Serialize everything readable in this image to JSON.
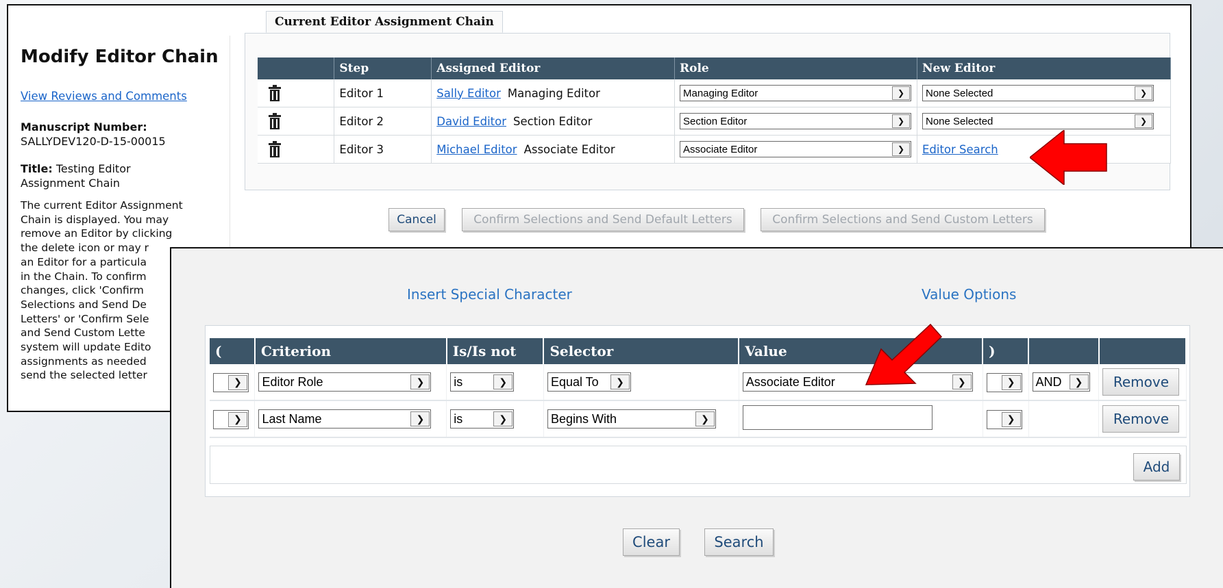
{
  "page_title": "Modify Editor Chain",
  "sidebar": {
    "view_reviews_link": "View Reviews and Comments",
    "manuscript_label": "Manuscript Number:",
    "manuscript_value": "SALLYDEV120-D-15-00015",
    "title_label": "Title:",
    "title_value_line1": "Testing Editor",
    "title_value_line2": "Assignment Chain",
    "description_lines": [
      "The current Editor Assignment",
      "Chain is displayed. You may",
      "remove an Editor by clicking",
      "the delete icon or may r",
      "an Editor for a particula",
      "in the Chain. To confirm",
      "changes, click 'Confirm",
      "Selections and Send De",
      "Letters' or 'Confirm Sele",
      "and Send Custom Lette",
      "system will update Edito",
      "assignments as needed",
      "send the selected letter"
    ]
  },
  "chain": {
    "tab_label": "Current Editor Assignment Chain",
    "headers": [
      "",
      "Step",
      "Assigned Editor",
      "Role",
      "New Editor"
    ],
    "rows": [
      {
        "step": "Editor 1",
        "editor_name": "Sally Editor",
        "editor_role": "Managing Editor",
        "role_select": "Managing Editor",
        "new_editor": "None Selected"
      },
      {
        "step": "Editor 2",
        "editor_name": "David Editor",
        "editor_role": "Section Editor",
        "role_select": "Section Editor",
        "new_editor": "None Selected"
      },
      {
        "step": "Editor 3",
        "editor_name": "Michael Editor",
        "editor_role": "Associate Editor",
        "role_select": "Associate Editor",
        "new_editor_link": "Editor Search"
      }
    ],
    "cancel_label": "Cancel",
    "confirm_default_label": "Confirm Selections and Send Default Letters",
    "confirm_custom_label": "Confirm Selections and Send Custom Letters"
  },
  "search": {
    "insert_special_char": "Insert Special Character",
    "value_options": "Value Options",
    "headers": [
      "(",
      "Criterion",
      "Is/Is not",
      "Selector",
      "Value",
      ")",
      "",
      ""
    ],
    "rows": [
      {
        "open": "",
        "criterion": "Editor Role",
        "is": "is",
        "selector": "Equal To",
        "value": "Associate Editor",
        "close": "",
        "conj": "AND",
        "remove": "Remove"
      },
      {
        "open": "",
        "criterion": "Last Name",
        "is": "is",
        "selector": "Begins With",
        "value": "",
        "close": "",
        "remove": "Remove"
      }
    ],
    "add_label": "Add",
    "clear_label": "Clear",
    "search_label": "Search"
  },
  "colors": {
    "header_bg": "#3c5568",
    "link": "#1b65c9",
    "arrow": "#ff0000"
  }
}
